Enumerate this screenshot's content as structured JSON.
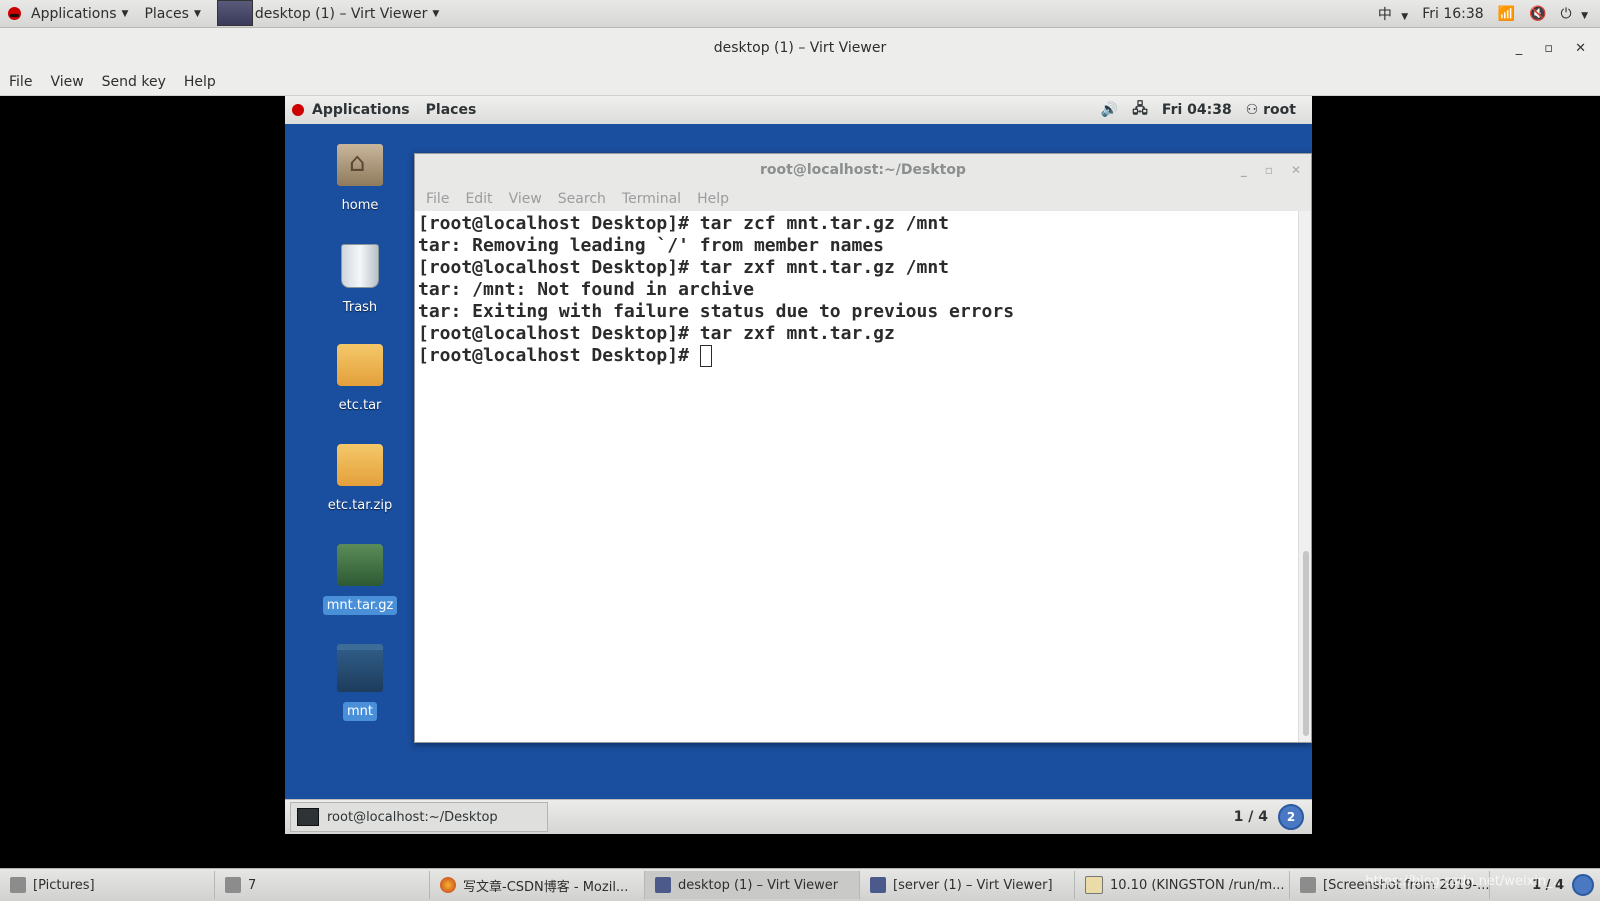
{
  "host_panel": {
    "applications": "Applications",
    "places": "Places",
    "window_label": "desktop (1) – Virt Viewer",
    "input_method": "中",
    "clock": "Fri 16:38"
  },
  "host_window": {
    "title": "desktop (1) – Virt Viewer",
    "menu": [
      "File",
      "View",
      "Send key",
      "Help"
    ]
  },
  "guest_panel": {
    "applications": "Applications",
    "places": "Places",
    "clock": "Fri 04:38",
    "user": "root"
  },
  "desktop_icons": [
    {
      "label": "home",
      "icon": "home-folder-icon",
      "selected": false
    },
    {
      "label": "Trash",
      "icon": "trash-icon",
      "selected": false
    },
    {
      "label": "etc.tar",
      "icon": "package-icon",
      "selected": false
    },
    {
      "label": "etc.tar.zip",
      "icon": "package-icon",
      "selected": false
    },
    {
      "label": "mnt.tar.gz",
      "icon": "package-icon",
      "selected": true
    },
    {
      "label": "mnt",
      "icon": "folder-icon",
      "selected": true
    }
  ],
  "terminal": {
    "title": "root@localhost:~/Desktop",
    "menu": [
      "File",
      "Edit",
      "View",
      "Search",
      "Terminal",
      "Help"
    ],
    "lines": [
      "[root@localhost Desktop]# tar zcf mnt.tar.gz /mnt",
      "tar: Removing leading `/' from member names",
      "[root@localhost Desktop]# tar zxf mnt.tar.gz /mnt",
      "tar: /mnt: Not found in archive",
      "tar: Exiting with failure status due to previous errors",
      "[root@localhost Desktop]# tar zxf mnt.tar.gz",
      "[root@localhost Desktop]# "
    ]
  },
  "guest_taskbar": {
    "task": "root@localhost:~/Desktop",
    "workspace": "1 / 4",
    "badge": "2"
  },
  "host_taskbar": {
    "items": [
      {
        "label": "[Pictures]",
        "active": false
      },
      {
        "label": "7",
        "active": false
      },
      {
        "label": "写文章-CSDN博客 - Mozil...",
        "active": false
      },
      {
        "label": "desktop (1) – Virt Viewer",
        "active": true
      },
      {
        "label": "[server (1) – Virt Viewer]",
        "active": false
      },
      {
        "label": "10.10 (KINGSTON /run/m...",
        "active": false
      },
      {
        "label": "[Screenshot from 2019-...",
        "active": false
      }
    ],
    "workspace": "1 / 4",
    "watermark": "https://blog.csdn.net/weixin_..."
  }
}
